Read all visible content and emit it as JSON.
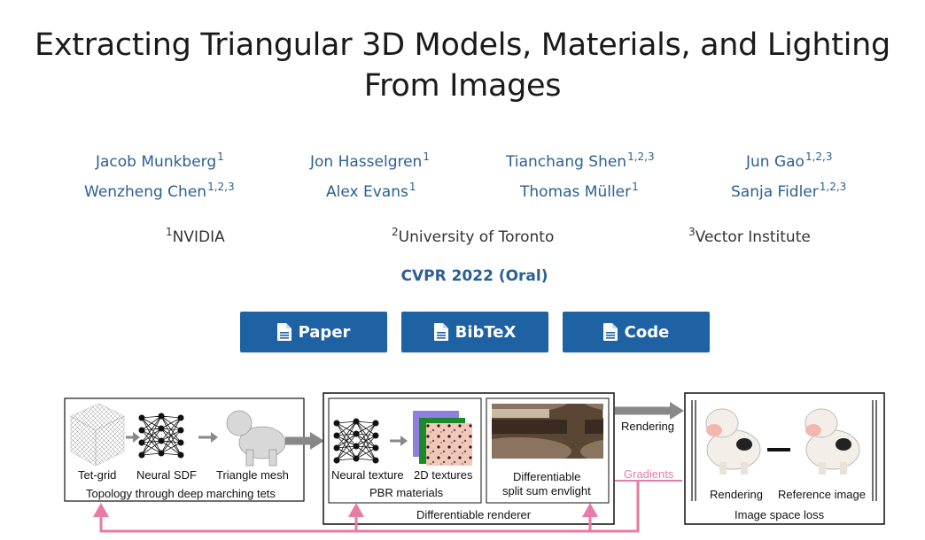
{
  "title_line1": "Extracting Triangular 3D Models, Materials, and Lighting",
  "title_line2": "From Images",
  "authors": [
    {
      "name": "Jacob Munkberg",
      "sup": "1"
    },
    {
      "name": "Jon Hasselgren",
      "sup": "1"
    },
    {
      "name": "Tianchang Shen",
      "sup": "1,2,3"
    },
    {
      "name": "Jun Gao",
      "sup": "1,2,3"
    },
    {
      "name": "Wenzheng Chen",
      "sup": "1,2,3"
    },
    {
      "name": "Alex Evans",
      "sup": "1"
    },
    {
      "name": "Thomas Müller",
      "sup": "1"
    },
    {
      "name": "Sanja Fidler",
      "sup": "1,2,3"
    }
  ],
  "affiliations": [
    {
      "sup": "1",
      "name": "NVIDIA"
    },
    {
      "sup": "2",
      "name": "University of Toronto"
    },
    {
      "sup": "3",
      "name": "Vector Institute"
    }
  ],
  "venue": "CVPR 2022 (Oral)",
  "buttons": [
    {
      "label": "Paper",
      "icon": "file-icon"
    },
    {
      "label": "BibTeX",
      "icon": "file-icon"
    },
    {
      "label": "Code",
      "icon": "file-icon"
    }
  ],
  "figure": {
    "tetgrid": "Tet-grid",
    "neural_sdf": "Neural SDF",
    "triangle_mesh": "Triangle mesh",
    "topology": "Topology through deep marching tets",
    "neural_texture": "Neural texture",
    "textures_2d": "2D textures",
    "pbr": "PBR materials",
    "diff_line1": "Differentiable",
    "diff_line2": "split sum envlight",
    "diff_renderer": "Differentiable renderer",
    "rendering_arrow": "Rendering",
    "gradients": "Gradients",
    "rendering": "Rendering",
    "reference": "Reference image",
    "loss": "Image space loss",
    "colors": {
      "pink": "#e87aa8",
      "gray_arrow": "#808080",
      "tex_purple": "#8e7fe0",
      "tex_green": "#1d8a2a"
    }
  }
}
